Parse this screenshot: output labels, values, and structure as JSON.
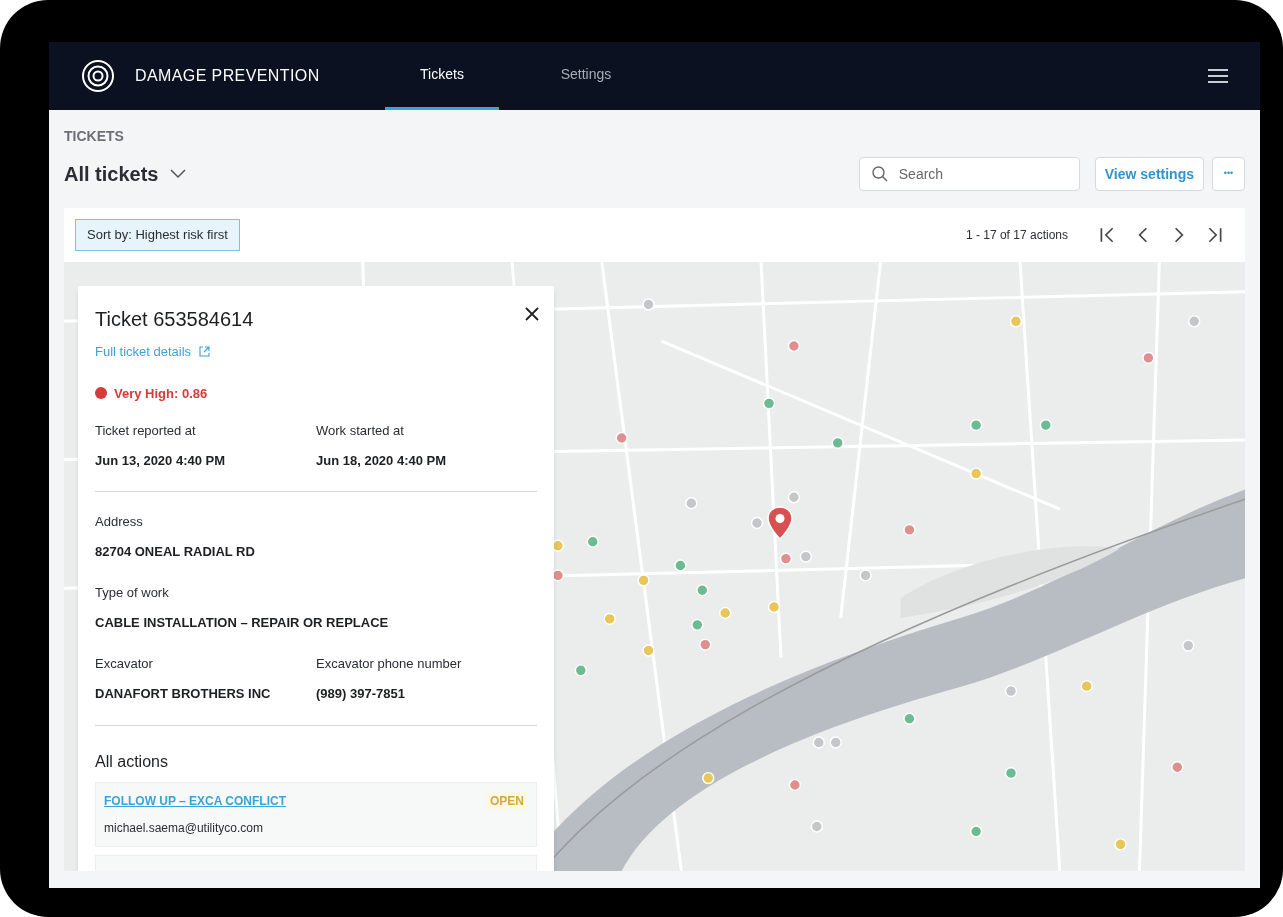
{
  "app": {
    "title": "DAMAGE PREVENTION"
  },
  "tabs": [
    {
      "label": "Tickets",
      "selected": true
    },
    {
      "label": "Settings",
      "selected": false
    }
  ],
  "page": {
    "section": "TICKETS",
    "view": "All tickets"
  },
  "search": {
    "placeholder": "Search"
  },
  "view_settings": "View settings",
  "more": "•••",
  "sort": "Sort by: Highest risk first",
  "pagination": "1 - 17 of 17 actions",
  "ticket": {
    "title": "Ticket 653584614",
    "details_link": "Full ticket details",
    "risk": {
      "label": "Very High: 0.86",
      "color": "#d63a3a"
    },
    "fields": [
      {
        "label": "Ticket reported at",
        "value": "Jun 13, 2020 4:40 PM"
      },
      {
        "label": "Work started at",
        "value": "Jun 18, 2020 4:40 PM"
      }
    ],
    "details": [
      {
        "label": "Address",
        "value": "82704 ONEAL RADIAL RD"
      },
      {
        "label": "Type of work",
        "value": "CABLE INSTALLATION – REPAIR OR REPLACE"
      }
    ],
    "contact": [
      {
        "label": "Excavator",
        "value": "DANAFORT BROTHERS INC"
      },
      {
        "label": "Excavator phone number",
        "value": "(989) 397-7851"
      }
    ],
    "actions_title": "All actions",
    "actions": [
      {
        "title": "FOLLOW UP – EXCA CONFLICT",
        "assignee": "michael.saema@utilityco.com",
        "status": "OPEN"
      }
    ]
  }
}
